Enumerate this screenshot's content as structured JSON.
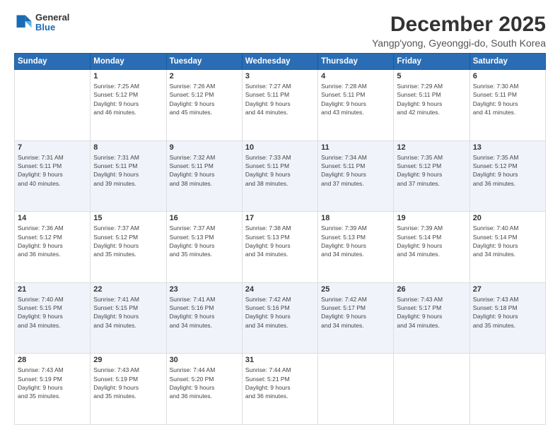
{
  "logo": {
    "general": "General",
    "blue": "Blue"
  },
  "title": "December 2025",
  "subtitle": "Yangp'yong, Gyeonggi-do, South Korea",
  "days": [
    "Sunday",
    "Monday",
    "Tuesday",
    "Wednesday",
    "Thursday",
    "Friday",
    "Saturday"
  ],
  "weeks": [
    [
      {
        "day": "",
        "info": ""
      },
      {
        "day": "1",
        "info": "Sunrise: 7:25 AM\nSunset: 5:12 PM\nDaylight: 9 hours\nand 46 minutes."
      },
      {
        "day": "2",
        "info": "Sunrise: 7:26 AM\nSunset: 5:12 PM\nDaylight: 9 hours\nand 45 minutes."
      },
      {
        "day": "3",
        "info": "Sunrise: 7:27 AM\nSunset: 5:11 PM\nDaylight: 9 hours\nand 44 minutes."
      },
      {
        "day": "4",
        "info": "Sunrise: 7:28 AM\nSunset: 5:11 PM\nDaylight: 9 hours\nand 43 minutes."
      },
      {
        "day": "5",
        "info": "Sunrise: 7:29 AM\nSunset: 5:11 PM\nDaylight: 9 hours\nand 42 minutes."
      },
      {
        "day": "6",
        "info": "Sunrise: 7:30 AM\nSunset: 5:11 PM\nDaylight: 9 hours\nand 41 minutes."
      }
    ],
    [
      {
        "day": "7",
        "info": "Sunrise: 7:31 AM\nSunset: 5:11 PM\nDaylight: 9 hours\nand 40 minutes."
      },
      {
        "day": "8",
        "info": "Sunrise: 7:31 AM\nSunset: 5:11 PM\nDaylight: 9 hours\nand 39 minutes."
      },
      {
        "day": "9",
        "info": "Sunrise: 7:32 AM\nSunset: 5:11 PM\nDaylight: 9 hours\nand 38 minutes."
      },
      {
        "day": "10",
        "info": "Sunrise: 7:33 AM\nSunset: 5:11 PM\nDaylight: 9 hours\nand 38 minutes."
      },
      {
        "day": "11",
        "info": "Sunrise: 7:34 AM\nSunset: 5:11 PM\nDaylight: 9 hours\nand 37 minutes."
      },
      {
        "day": "12",
        "info": "Sunrise: 7:35 AM\nSunset: 5:12 PM\nDaylight: 9 hours\nand 37 minutes."
      },
      {
        "day": "13",
        "info": "Sunrise: 7:35 AM\nSunset: 5:12 PM\nDaylight: 9 hours\nand 36 minutes."
      }
    ],
    [
      {
        "day": "14",
        "info": "Sunrise: 7:36 AM\nSunset: 5:12 PM\nDaylight: 9 hours\nand 36 minutes."
      },
      {
        "day": "15",
        "info": "Sunrise: 7:37 AM\nSunset: 5:12 PM\nDaylight: 9 hours\nand 35 minutes."
      },
      {
        "day": "16",
        "info": "Sunrise: 7:37 AM\nSunset: 5:13 PM\nDaylight: 9 hours\nand 35 minutes."
      },
      {
        "day": "17",
        "info": "Sunrise: 7:38 AM\nSunset: 5:13 PM\nDaylight: 9 hours\nand 34 minutes."
      },
      {
        "day": "18",
        "info": "Sunrise: 7:39 AM\nSunset: 5:13 PM\nDaylight: 9 hours\nand 34 minutes."
      },
      {
        "day": "19",
        "info": "Sunrise: 7:39 AM\nSunset: 5:14 PM\nDaylight: 9 hours\nand 34 minutes."
      },
      {
        "day": "20",
        "info": "Sunrise: 7:40 AM\nSunset: 5:14 PM\nDaylight: 9 hours\nand 34 minutes."
      }
    ],
    [
      {
        "day": "21",
        "info": "Sunrise: 7:40 AM\nSunset: 5:15 PM\nDaylight: 9 hours\nand 34 minutes."
      },
      {
        "day": "22",
        "info": "Sunrise: 7:41 AM\nSunset: 5:15 PM\nDaylight: 9 hours\nand 34 minutes."
      },
      {
        "day": "23",
        "info": "Sunrise: 7:41 AM\nSunset: 5:16 PM\nDaylight: 9 hours\nand 34 minutes."
      },
      {
        "day": "24",
        "info": "Sunrise: 7:42 AM\nSunset: 5:16 PM\nDaylight: 9 hours\nand 34 minutes."
      },
      {
        "day": "25",
        "info": "Sunrise: 7:42 AM\nSunset: 5:17 PM\nDaylight: 9 hours\nand 34 minutes."
      },
      {
        "day": "26",
        "info": "Sunrise: 7:43 AM\nSunset: 5:17 PM\nDaylight: 9 hours\nand 34 minutes."
      },
      {
        "day": "27",
        "info": "Sunrise: 7:43 AM\nSunset: 5:18 PM\nDaylight: 9 hours\nand 35 minutes."
      }
    ],
    [
      {
        "day": "28",
        "info": "Sunrise: 7:43 AM\nSunset: 5:19 PM\nDaylight: 9 hours\nand 35 minutes."
      },
      {
        "day": "29",
        "info": "Sunrise: 7:43 AM\nSunset: 5:19 PM\nDaylight: 9 hours\nand 35 minutes."
      },
      {
        "day": "30",
        "info": "Sunrise: 7:44 AM\nSunset: 5:20 PM\nDaylight: 9 hours\nand 36 minutes."
      },
      {
        "day": "31",
        "info": "Sunrise: 7:44 AM\nSunset: 5:21 PM\nDaylight: 9 hours\nand 36 minutes."
      },
      {
        "day": "",
        "info": ""
      },
      {
        "day": "",
        "info": ""
      },
      {
        "day": "",
        "info": ""
      }
    ]
  ]
}
